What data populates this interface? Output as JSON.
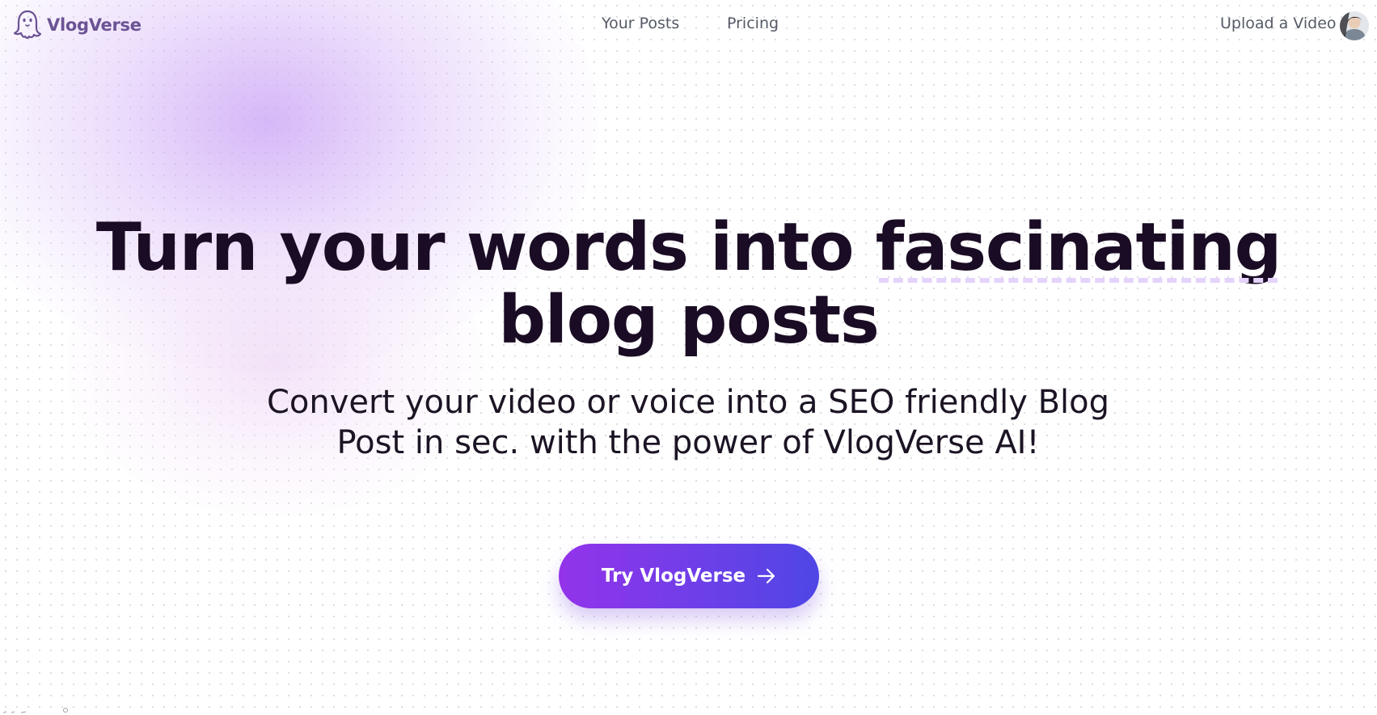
{
  "header": {
    "brand_name": "VlogVerse",
    "nav": [
      {
        "label": "Your Posts"
      },
      {
        "label": "Pricing"
      }
    ],
    "upload_label": "Upload a Video"
  },
  "hero": {
    "title_part1": "Turn your words into ",
    "title_accent": "fascinating",
    "title_part2": "blog posts",
    "subtitle": "Convert your video or voice into a SEO friendly Blog Post in sec. with the power of VlogVerse AI!",
    "cta_label": "Try VlogVerse"
  },
  "icons": {
    "logo": "ghost-icon",
    "avatar": "user-avatar",
    "cta_arrow": "arrow-right-icon"
  },
  "colors": {
    "brand_text": "#6b5394",
    "title_text": "#1a0c24",
    "accent_underline": "#e4d3fb",
    "cta_gradient_start": "#9333ea",
    "cta_gradient_end": "#4f46e5",
    "nav_text": "#555a66"
  }
}
